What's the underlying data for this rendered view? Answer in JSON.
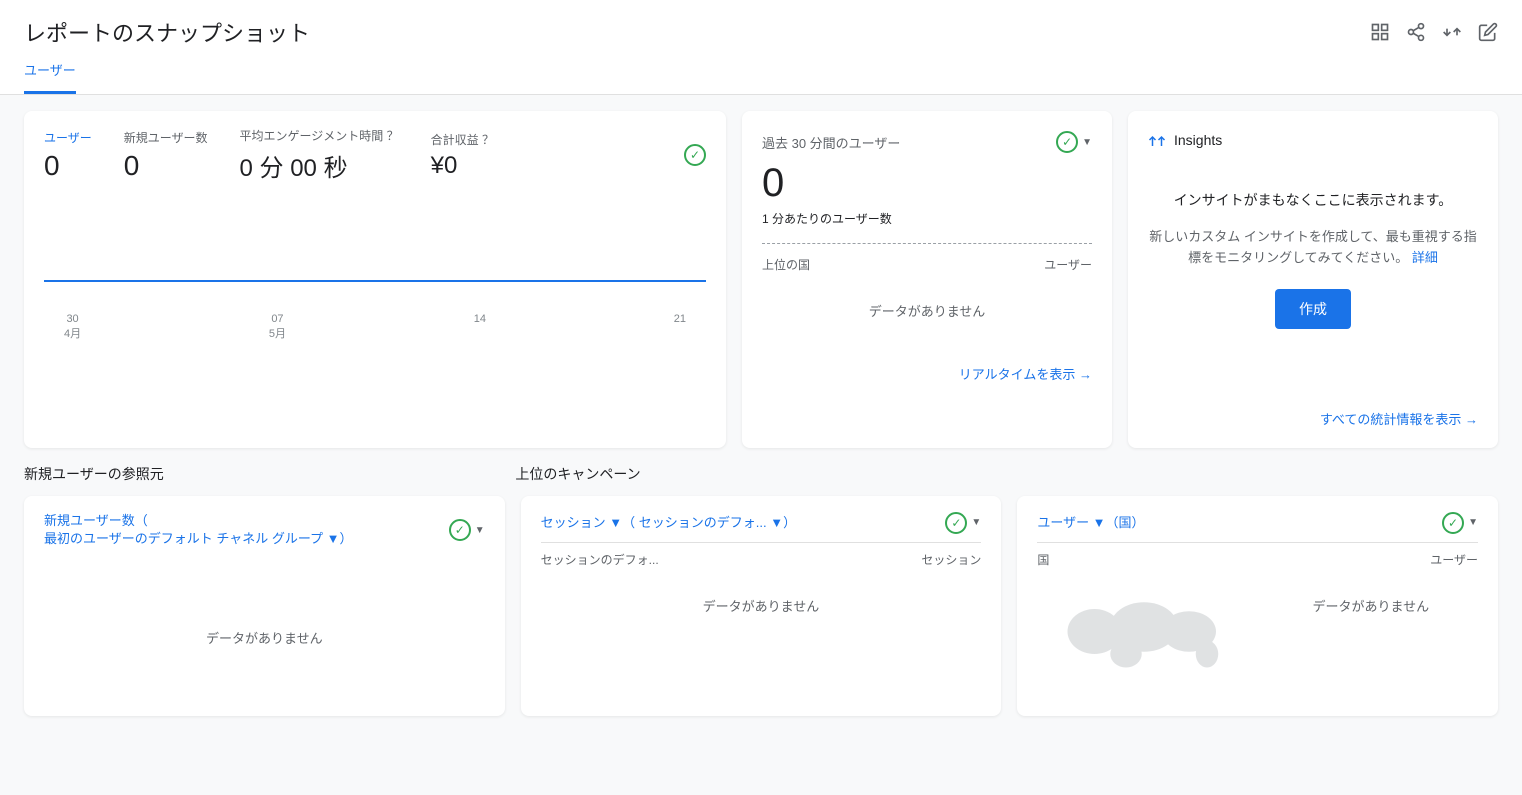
{
  "header": {
    "title": "レポートのスナップショット",
    "icons": [
      "grid-icon",
      "share-icon",
      "compare-icon",
      "edit-icon"
    ]
  },
  "tabs": [
    {
      "label": "ユーザー",
      "active": true
    }
  ],
  "metricsCard": {
    "user_label": "ユーザー",
    "user_value": "0",
    "new_user_label": "新規ユーザー数",
    "new_user_value": "0",
    "engagement_label": "平均エンゲージメント時間 ？",
    "engagement_value": "0 分 00 秒",
    "revenue_label": "合計収益 ？",
    "revenue_value": "¥0",
    "chart_x_labels": [
      "30\n4月",
      "07\n5月",
      "14",
      "21"
    ]
  },
  "realtimeCard": {
    "title": "過去 30 分間のユーザー",
    "value": "0",
    "sublabel": "1 分あたりのユーザー数",
    "col_country": "上位の国",
    "col_users": "ユーザー",
    "no_data": "データがありません",
    "view_link": "リアルタイムを表示 →"
  },
  "insightsCard": {
    "title": "Insights",
    "teaser": "インサイトがまもなくここに表示されます。",
    "description": "新しいカスタム インサイトを作成して、最も重視する指標をモニタリングしてみてください。",
    "link_text": "詳細",
    "create_button": "作成",
    "view_link": "すべての統計情報を表示 →"
  },
  "newUsersSection": {
    "title": "新規ユーザーの参照元"
  },
  "newUsersCard": {
    "title_line1": "新規ユーザー数（",
    "title_line2": "最初のユーザーのデフォルト チャネル グループ ▼）",
    "no_data": "データがありません"
  },
  "campaignSection": {
    "title": "上位のキャンペーン"
  },
  "campaignCard": {
    "title_sessions": "セッション ▼（",
    "title_sessions2": "セッションのデフォ... ▼）",
    "col_sessions_label": "セッションのデフォ...",
    "col_sessions_value": "セッション",
    "no_data": "データがありません"
  },
  "countryCard": {
    "title": "ユーザー ▼（国）",
    "col_country": "国",
    "col_users": "ユーザー",
    "no_data": "データがありません"
  },
  "colors": {
    "blue": "#1a73e8",
    "green": "#34a853",
    "gray": "#5f6368",
    "light_gray": "#f8f9fa"
  }
}
